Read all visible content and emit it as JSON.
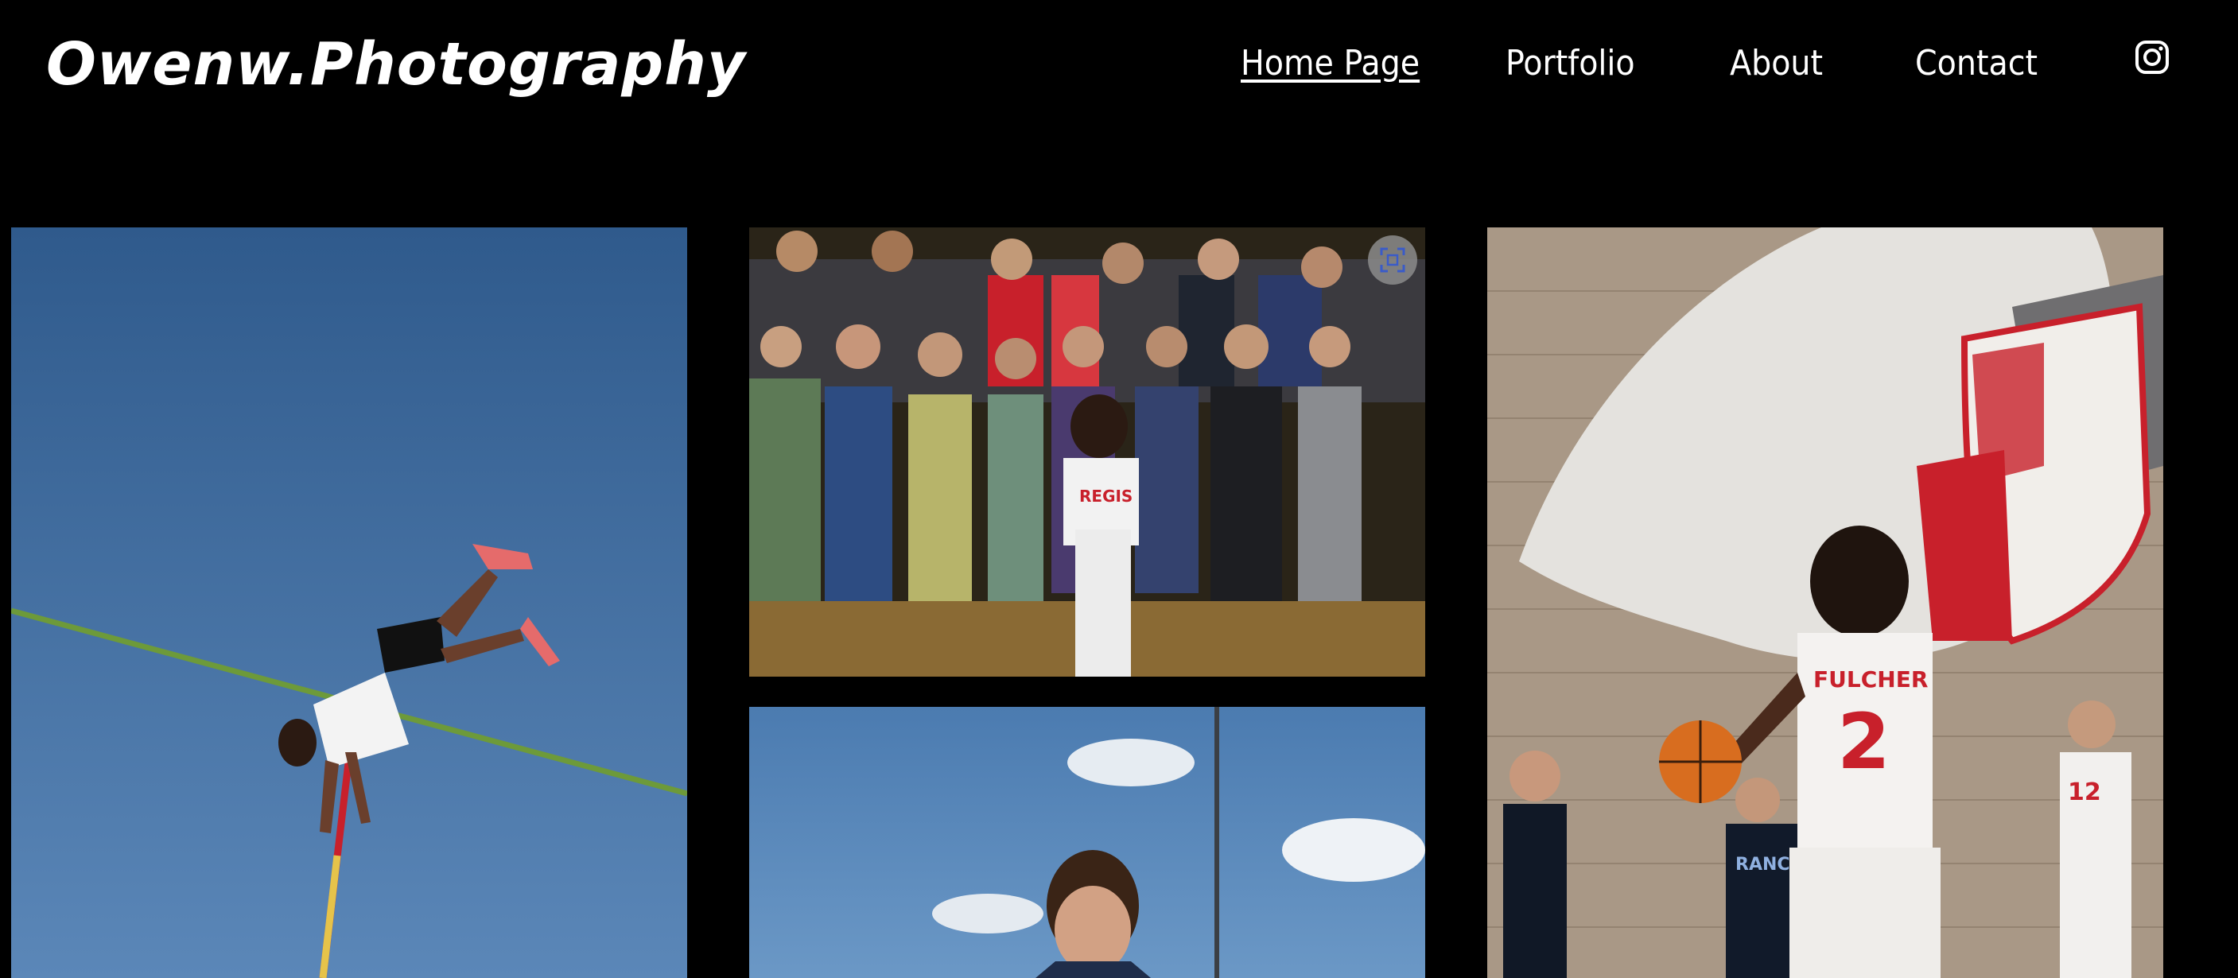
{
  "site": {
    "logo": "Owenw.Photography"
  },
  "nav": {
    "items": [
      {
        "label": "Home Page",
        "active": true
      },
      {
        "label": "Portfolio",
        "active": false
      },
      {
        "label": "About",
        "active": false
      },
      {
        "label": "Contact",
        "active": false
      }
    ],
    "social_icon": "instagram-icon"
  },
  "gallery": {
    "images": [
      {
        "subject": "Pole vaulter clearing the bar against a blue sky"
      },
      {
        "subject": "Basketball player bent over in front of a crowd of student fans"
      },
      {
        "subject": "Player in a blue jersey under a partly cloudy sky"
      },
      {
        "subject": "Player in a red and white jersey dribbling past a wall mural of a knight on horseback",
        "jersey_name": "FULCHER",
        "jersey_number": "2",
        "opponent_jersey_text": "RANCH"
      }
    ],
    "expand_icon": "expand-icon"
  },
  "colors": {
    "background": "#000000",
    "text": "#ffffff",
    "sky": "#4a76a8",
    "jersey_red": "#c8202b"
  }
}
